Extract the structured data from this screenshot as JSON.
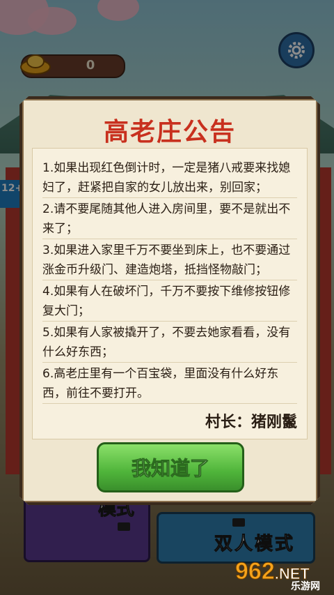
{
  "hud": {
    "coin_count": "0",
    "age_badge": "12+"
  },
  "dialog": {
    "title": "高老庄公告",
    "items": [
      "1.如果出现红色倒计时，一定是猪八戒要来找媳妇了，赶紧把自家的女儿放出来，别回家；",
      "2.请不要尾随其他人进入房间里，要不是就出不来了；",
      "3.如果进入家里千万不要坐到床上，也不要通过涨金币升级门、建造炮塔，抵挡怪物敲门；",
      "4.如果有人在破坏门，千万不要按下维修按钮修复大门；",
      "5.如果有人家被撬开了，不要去她家看看，没有什么好东西；",
      "6.高老庄里有一个百宝袋，里面没有什么好东西，前往不要打开。"
    ],
    "signature": "村长：猪刚鬣",
    "ok_label": "我知道了"
  },
  "modes": {
    "left_label": "模式",
    "right_label": "双人模式"
  },
  "watermark": {
    "number": "962",
    "suffix": ".NET",
    "cn": "乐游网"
  },
  "colors": {
    "title_red": "#c8301e",
    "button_green": "#4fb43a",
    "gear_blue": "#2f6fa8"
  },
  "icons": [
    "gold-ingot-icon",
    "gear-icon",
    "video-icon"
  ]
}
